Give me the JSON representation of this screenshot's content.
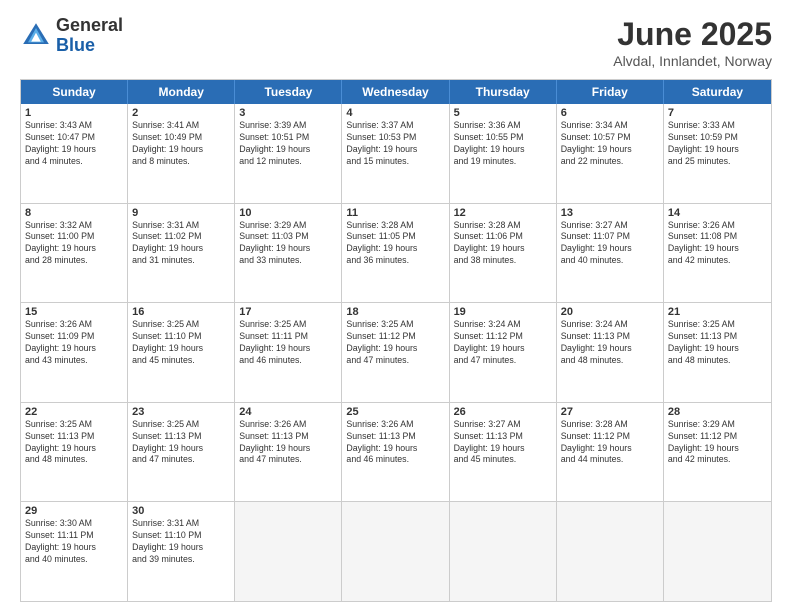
{
  "logo": {
    "general": "General",
    "blue": "Blue"
  },
  "title": "June 2025",
  "location": "Alvdal, Innlandet, Norway",
  "days": [
    "Sunday",
    "Monday",
    "Tuesday",
    "Wednesday",
    "Thursday",
    "Friday",
    "Saturday"
  ],
  "weeks": [
    [
      {
        "day": "1",
        "info": "Sunrise: 3:43 AM\nSunset: 10:47 PM\nDaylight: 19 hours\nand 4 minutes."
      },
      {
        "day": "2",
        "info": "Sunrise: 3:41 AM\nSunset: 10:49 PM\nDaylight: 19 hours\nand 8 minutes."
      },
      {
        "day": "3",
        "info": "Sunrise: 3:39 AM\nSunset: 10:51 PM\nDaylight: 19 hours\nand 12 minutes."
      },
      {
        "day": "4",
        "info": "Sunrise: 3:37 AM\nSunset: 10:53 PM\nDaylight: 19 hours\nand 15 minutes."
      },
      {
        "day": "5",
        "info": "Sunrise: 3:36 AM\nSunset: 10:55 PM\nDaylight: 19 hours\nand 19 minutes."
      },
      {
        "day": "6",
        "info": "Sunrise: 3:34 AM\nSunset: 10:57 PM\nDaylight: 19 hours\nand 22 minutes."
      },
      {
        "day": "7",
        "info": "Sunrise: 3:33 AM\nSunset: 10:59 PM\nDaylight: 19 hours\nand 25 minutes."
      }
    ],
    [
      {
        "day": "8",
        "info": "Sunrise: 3:32 AM\nSunset: 11:00 PM\nDaylight: 19 hours\nand 28 minutes."
      },
      {
        "day": "9",
        "info": "Sunrise: 3:31 AM\nSunset: 11:02 PM\nDaylight: 19 hours\nand 31 minutes."
      },
      {
        "day": "10",
        "info": "Sunrise: 3:29 AM\nSunset: 11:03 PM\nDaylight: 19 hours\nand 33 minutes."
      },
      {
        "day": "11",
        "info": "Sunrise: 3:28 AM\nSunset: 11:05 PM\nDaylight: 19 hours\nand 36 minutes."
      },
      {
        "day": "12",
        "info": "Sunrise: 3:28 AM\nSunset: 11:06 PM\nDaylight: 19 hours\nand 38 minutes."
      },
      {
        "day": "13",
        "info": "Sunrise: 3:27 AM\nSunset: 11:07 PM\nDaylight: 19 hours\nand 40 minutes."
      },
      {
        "day": "14",
        "info": "Sunrise: 3:26 AM\nSunset: 11:08 PM\nDaylight: 19 hours\nand 42 minutes."
      }
    ],
    [
      {
        "day": "15",
        "info": "Sunrise: 3:26 AM\nSunset: 11:09 PM\nDaylight: 19 hours\nand 43 minutes."
      },
      {
        "day": "16",
        "info": "Sunrise: 3:25 AM\nSunset: 11:10 PM\nDaylight: 19 hours\nand 45 minutes."
      },
      {
        "day": "17",
        "info": "Sunrise: 3:25 AM\nSunset: 11:11 PM\nDaylight: 19 hours\nand 46 minutes."
      },
      {
        "day": "18",
        "info": "Sunrise: 3:25 AM\nSunset: 11:12 PM\nDaylight: 19 hours\nand 47 minutes."
      },
      {
        "day": "19",
        "info": "Sunrise: 3:24 AM\nSunset: 11:12 PM\nDaylight: 19 hours\nand 47 minutes."
      },
      {
        "day": "20",
        "info": "Sunrise: 3:24 AM\nSunset: 11:13 PM\nDaylight: 19 hours\nand 48 minutes."
      },
      {
        "day": "21",
        "info": "Sunrise: 3:25 AM\nSunset: 11:13 PM\nDaylight: 19 hours\nand 48 minutes."
      }
    ],
    [
      {
        "day": "22",
        "info": "Sunrise: 3:25 AM\nSunset: 11:13 PM\nDaylight: 19 hours\nand 48 minutes."
      },
      {
        "day": "23",
        "info": "Sunrise: 3:25 AM\nSunset: 11:13 PM\nDaylight: 19 hours\nand 47 minutes."
      },
      {
        "day": "24",
        "info": "Sunrise: 3:26 AM\nSunset: 11:13 PM\nDaylight: 19 hours\nand 47 minutes."
      },
      {
        "day": "25",
        "info": "Sunrise: 3:26 AM\nSunset: 11:13 PM\nDaylight: 19 hours\nand 46 minutes."
      },
      {
        "day": "26",
        "info": "Sunrise: 3:27 AM\nSunset: 11:13 PM\nDaylight: 19 hours\nand 45 minutes."
      },
      {
        "day": "27",
        "info": "Sunrise: 3:28 AM\nSunset: 11:12 PM\nDaylight: 19 hours\nand 44 minutes."
      },
      {
        "day": "28",
        "info": "Sunrise: 3:29 AM\nSunset: 11:12 PM\nDaylight: 19 hours\nand 42 minutes."
      }
    ],
    [
      {
        "day": "29",
        "info": "Sunrise: 3:30 AM\nSunset: 11:11 PM\nDaylight: 19 hours\nand 40 minutes."
      },
      {
        "day": "30",
        "info": "Sunrise: 3:31 AM\nSunset: 11:10 PM\nDaylight: 19 hours\nand 39 minutes."
      },
      {
        "day": "",
        "info": ""
      },
      {
        "day": "",
        "info": ""
      },
      {
        "day": "",
        "info": ""
      },
      {
        "day": "",
        "info": ""
      },
      {
        "day": "",
        "info": ""
      }
    ]
  ]
}
